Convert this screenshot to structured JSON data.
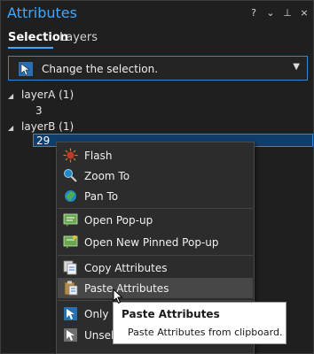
{
  "pane": {
    "title": "Attributes",
    "title_buttons": [
      "?",
      "⌄",
      "⊥",
      "×"
    ]
  },
  "tabs": [
    {
      "label": "Selection",
      "active": true
    },
    {
      "label": "Layers",
      "active": false
    }
  ],
  "selection_mode": {
    "label": "Change the selection.",
    "icon": "selection-cursor-icon"
  },
  "tree": {
    "layers": [
      {
        "label": "layerA (1)",
        "items": [
          "3"
        ]
      },
      {
        "label": "layerB (1)",
        "items": [
          "29"
        ]
      }
    ]
  },
  "context_menu": {
    "items": [
      {
        "label": "Flash",
        "icon": "flash-icon"
      },
      {
        "label": "Zoom To",
        "icon": "zoom-to-icon"
      },
      {
        "label": "Pan To",
        "icon": "pan-to-icon"
      },
      {
        "label": "Open Pop-up",
        "icon": "popup-icon"
      },
      {
        "label": "Open New Pinned Pop-up",
        "icon": "pinned-popup-icon"
      },
      {
        "label": "Copy Attributes",
        "icon": "copy-attributes-icon"
      },
      {
        "label": "Paste Attributes",
        "icon": "paste-attributes-icon",
        "hovered": true
      },
      {
        "label": "Only Se",
        "icon": "only-select-icon"
      },
      {
        "label": "Unselec",
        "icon": "unselect-icon"
      }
    ]
  },
  "tooltip": {
    "title": "Paste Attributes",
    "description": "Paste Attributes from clipboard."
  },
  "colors": {
    "accent": "#3ea8ff",
    "background": "#1f1f1f",
    "menu_background": "#2c2c2c",
    "hover": "#474747",
    "selected_row": "#0f3e6b"
  }
}
